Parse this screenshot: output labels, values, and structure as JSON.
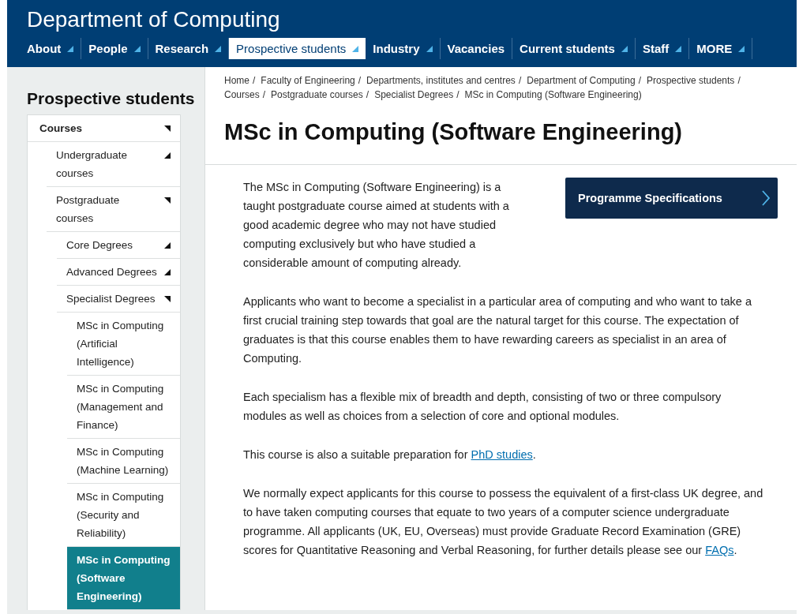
{
  "site_title": "Department of Computing",
  "nav": [
    {
      "label": "About",
      "has_submenu": true,
      "selected": false
    },
    {
      "label": "People",
      "has_submenu": true,
      "selected": false
    },
    {
      "label": "Research",
      "has_submenu": true,
      "selected": false
    },
    {
      "label": "Prospective students",
      "has_submenu": true,
      "selected": true
    },
    {
      "label": "Industry",
      "has_submenu": true,
      "selected": false
    },
    {
      "label": "Vacancies",
      "has_submenu": false,
      "selected": false
    },
    {
      "label": "Current students",
      "has_submenu": true,
      "selected": false
    },
    {
      "label": "Staff",
      "has_submenu": true,
      "selected": false
    },
    {
      "label": "MORE",
      "has_submenu": true,
      "selected": false
    }
  ],
  "sidebar": {
    "title": "Prospective students",
    "items": [
      {
        "label": "Courses",
        "expanded": true,
        "selected": false,
        "children": [
          {
            "label": "Undergraduate courses",
            "expanded": false,
            "selected": false
          },
          {
            "label": "Postgraduate courses",
            "expanded": true,
            "selected": false,
            "children": [
              {
                "label": "Core Degrees",
                "expanded": false,
                "selected": false
              },
              {
                "label": "Advanced Degrees",
                "expanded": false,
                "selected": false
              },
              {
                "label": "Specialist Degrees",
                "expanded": true,
                "selected": false,
                "children": [
                  {
                    "label": "MSc in Computing (Artificial Intelligence)",
                    "selected": false
                  },
                  {
                    "label": "MSc in Computing (Management and Finance)",
                    "selected": false
                  },
                  {
                    "label": "MSc in Computing (Machine Learning)",
                    "selected": false
                  },
                  {
                    "label": "MSc in Computing (Security and Reliability)",
                    "selected": false
                  },
                  {
                    "label": "MSc in Computing (Software Engineering)",
                    "selected": true
                  }
                ]
              }
            ]
          }
        ]
      }
    ]
  },
  "breadcrumb": [
    "Home",
    "Faculty of Engineering",
    "Departments, institutes and centres",
    "Department of Computing",
    "Prospective students",
    "Courses",
    "Postgraduate courses",
    "Specialist Degrees",
    "MSc in Computing (Software Engineering)"
  ],
  "breadcrumb_separator": "/",
  "page_title": "MSc in Computing (Software Engineering)",
  "side_button": {
    "label": "Programme Specifications"
  },
  "paragraphs": [
    [
      {
        "text": "The MSc in Computing (Software Engineering) is a taught postgraduate course aimed at students with a good academic degree who may not have studied computing exclusively but who have studied a considerable amount of computing already.",
        "link": false
      }
    ],
    [
      {
        "text": "Applicants who want to become a specialist in a particular area of computing and who want to take a first crucial training step towards that goal are the natural target for this course. The expectation of graduates is that this course enables them to have rewarding careers as specialist in an area of Computing.",
        "link": false
      }
    ],
    [
      {
        "text": "Each specialism has a flexible mix of breadth and depth, consisting of two or three compulsory modules as well as choices from a selection of core and optional modules.",
        "link": false
      }
    ],
    [
      {
        "text": "This course is also a suitable preparation for ",
        "link": false
      },
      {
        "text": "PhD studies",
        "link": true
      },
      {
        "text": ".",
        "link": false
      }
    ],
    [
      {
        "text": "We normally expect applicants for this course to possess the equivalent of a first-class UK degree, and to have taken computing courses that equate to two years of a computer science undergraduate programme. All applicants (UK, EU, Overseas) must provide Graduate Record Examination (GRE) scores for Quantitative Reasoning and Verbal Reasoning, for further details please see our ",
        "link": false
      },
      {
        "text": "FAQs",
        "link": true
      },
      {
        "text": ".",
        "link": false
      }
    ]
  ]
}
